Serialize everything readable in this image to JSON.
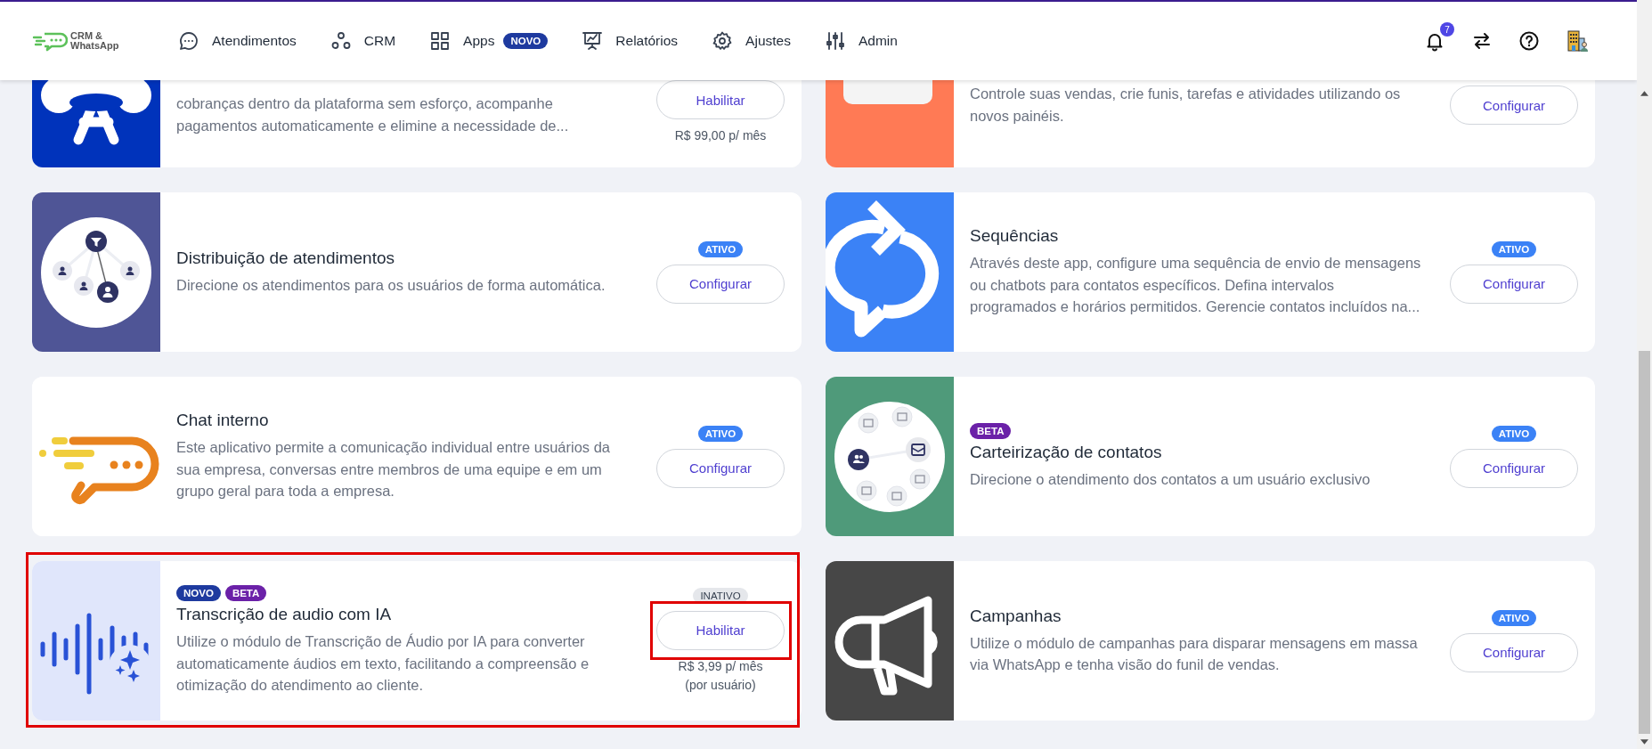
{
  "header": {
    "logo_text": [
      "CRM &",
      "WhatsApp"
    ],
    "nav": [
      {
        "label": "Atendimentos"
      },
      {
        "label": "CRM"
      },
      {
        "label": "Apps",
        "badge": "NOVO"
      },
      {
        "label": "Relatórios"
      },
      {
        "label": "Ajustes"
      },
      {
        "label": "Admin"
      }
    ],
    "notifications": {
      "count": "7"
    }
  },
  "apps": [
    {
      "description": "cobranças dentro da plataforma sem esforço, acompanhe pagamentos automaticamente e elimine a necessidade de...",
      "button": "Habilitar",
      "price_lines": [
        "R$ 99,00 p/ mês"
      ],
      "highlighted": false,
      "button_highlighted": false
    },
    {
      "description": "Controle suas vendas, crie funis, tarefas e atividades utilizando os novos painéis.",
      "button": "Configurar",
      "highlighted": false,
      "button_highlighted": false
    },
    {
      "title": "Distribuição de atendimentos",
      "description": "Direcione os atendimentos para os usuários de forma automática.",
      "status": {
        "label": "ATIVO",
        "kind": "active"
      },
      "button": "Configurar",
      "highlighted": false,
      "button_highlighted": false
    },
    {
      "title": "Sequências",
      "description": "Através deste app, configure uma sequência de envio de mensagens ou chatbots para contatos específicos. Defina intervalos programados e horários permitidos. Gerencie contatos incluídos na...",
      "status": {
        "label": "ATIVO",
        "kind": "active"
      },
      "button": "Configurar",
      "highlighted": false,
      "button_highlighted": false
    },
    {
      "title": "Chat interno",
      "description": "Este aplicativo permite a comunicação individual entre usuários da sua empresa, conversas entre membros de uma equipe e em um grupo geral para toda a empresa.",
      "status": {
        "label": "ATIVO",
        "kind": "active"
      },
      "button": "Configurar",
      "highlighted": false,
      "button_highlighted": false
    },
    {
      "badges": [
        {
          "label": "BETA",
          "kind": "beta"
        }
      ],
      "title": "Carteirização de contatos",
      "description": "Direcione o atendimento dos contatos a um usuário exclusivo",
      "status": {
        "label": "ATIVO",
        "kind": "active"
      },
      "button": "Configurar",
      "highlighted": false,
      "button_highlighted": false
    },
    {
      "badges": [
        {
          "label": "NOVO",
          "kind": "new"
        },
        {
          "label": "BETA",
          "kind": "beta"
        }
      ],
      "title": "Transcrição de audio com IA",
      "description": "Utilize o módulo de Transcrição de Áudio por IA para converter automaticamente áudios em texto, facilitando a compreensão e otimização do atendimento ao cliente.",
      "status": {
        "label": "INATIVO",
        "kind": "inactive"
      },
      "button": "Habilitar",
      "price_lines": [
        "R$ 3,99 p/ mês",
        "(por usuário)"
      ],
      "highlighted": true,
      "button_highlighted": true
    },
    {
      "title": "Campanhas",
      "description": "Utilize o módulo de campanhas para disparar mensagens em massa via WhatsApp e tenha visão do funil de vendas.",
      "status": {
        "label": "ATIVO",
        "kind": "active"
      },
      "button": "Configurar",
      "highlighted": false,
      "button_highlighted": false
    }
  ]
}
